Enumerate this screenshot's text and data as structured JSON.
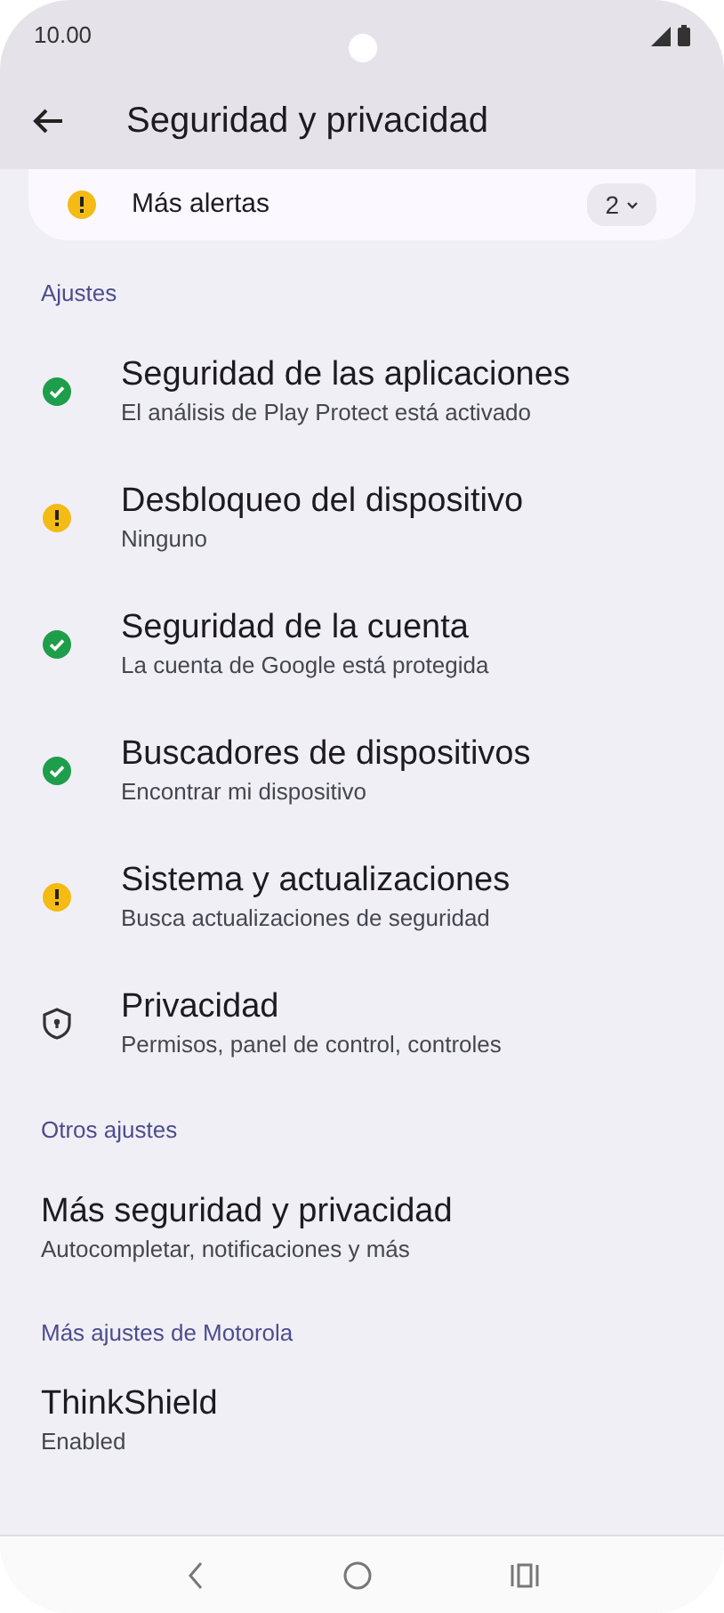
{
  "status_bar": {
    "time": "10.00"
  },
  "app_bar": {
    "title": "Seguridad y privacidad"
  },
  "alerts_card": {
    "label": "Más alertas",
    "count": "2"
  },
  "sections": [
    {
      "header": "Ajustes",
      "items": [
        {
          "kind": "ok",
          "title": "Seguridad de las aplicaciones",
          "subtitle": "El análisis de Play Protect está activado"
        },
        {
          "kind": "warning",
          "title": "Desbloqueo del dispositivo",
          "subtitle": "Ninguno"
        },
        {
          "kind": "ok",
          "title": "Seguridad de la cuenta",
          "subtitle": "La cuenta de Google está protegida"
        },
        {
          "kind": "ok",
          "title": "Buscadores de dispositivos",
          "subtitle": "Encontrar mi dispositivo"
        },
        {
          "kind": "warning",
          "title": "Sistema y actualizaciones",
          "subtitle": "Busca actualizaciones de seguridad"
        },
        {
          "kind": "shield",
          "title": "Privacidad",
          "subtitle": "Permisos, panel de control, controles"
        }
      ]
    },
    {
      "header": "Otros ajustes",
      "items": [
        {
          "kind": "plain",
          "title": "Más seguridad y privacidad",
          "subtitle": "Autocompletar, notificaciones y más"
        }
      ]
    },
    {
      "header": "Más ajustes de Motorola",
      "items": [
        {
          "kind": "plain",
          "title": "ThinkShield",
          "subtitle": "Enabled"
        }
      ]
    }
  ]
}
